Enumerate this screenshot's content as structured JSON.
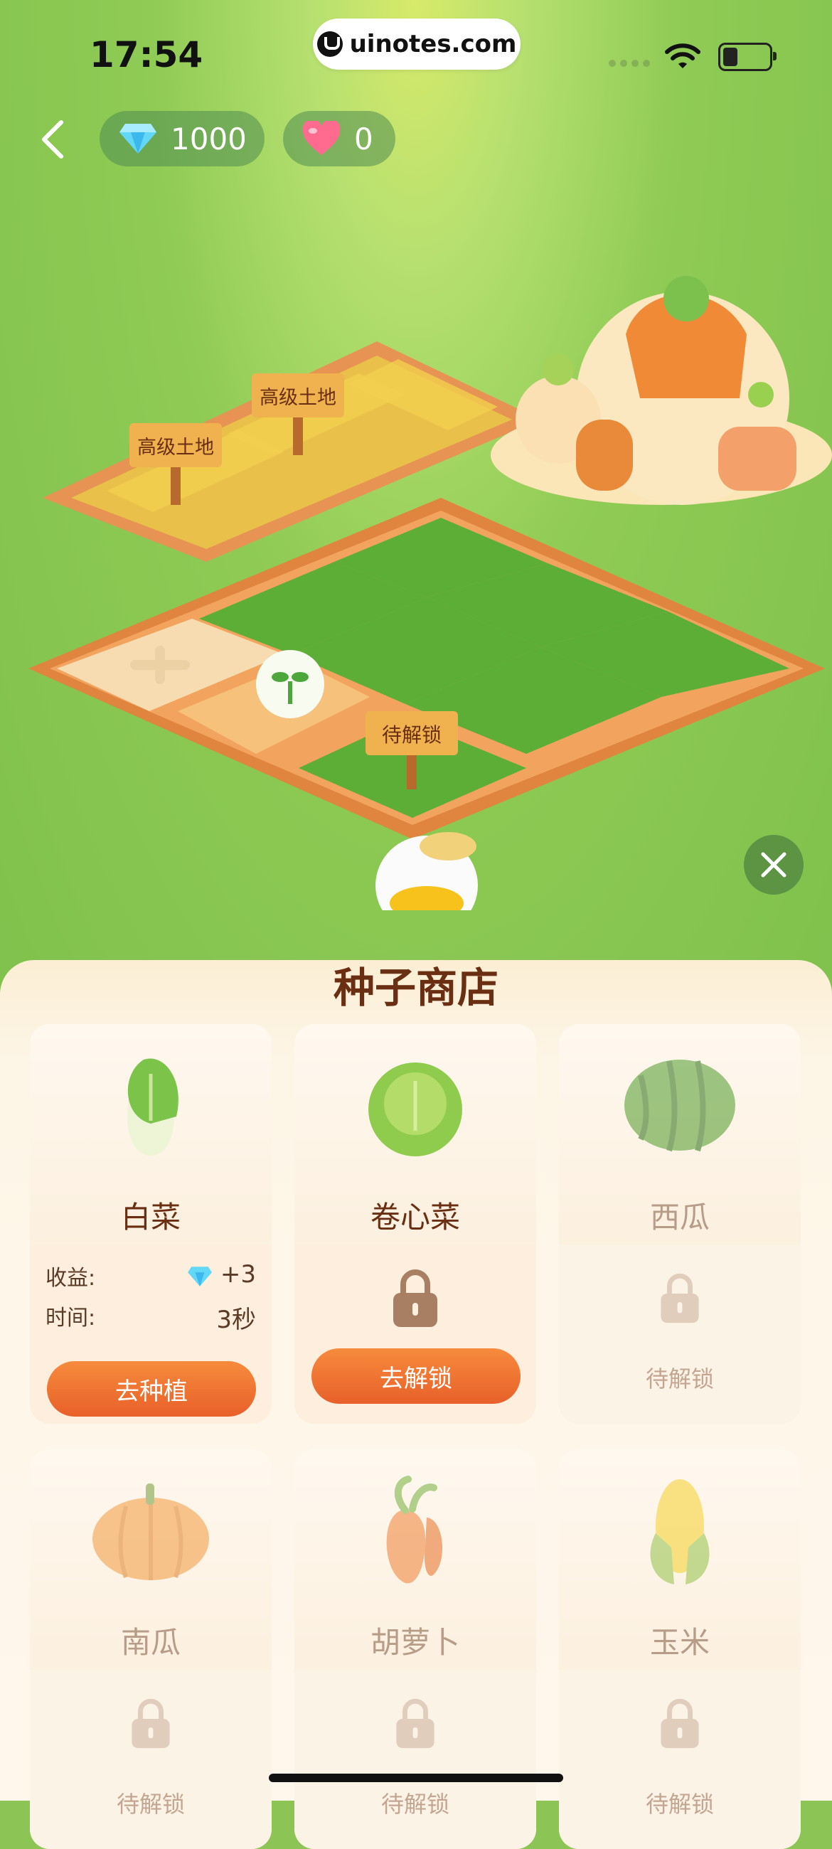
{
  "status_bar": {
    "time": "17:54",
    "url": "uinotes.com"
  },
  "header": {
    "gems": "1000",
    "hearts": "0"
  },
  "farm": {
    "signs": {
      "premium_land": "高级土地",
      "locked": "待解锁"
    }
  },
  "shop": {
    "title": "种子商店",
    "labels": {
      "income": "收益:",
      "time": "时间:"
    },
    "items": [
      {
        "name": "白菜",
        "income": "+3",
        "time": "3秒",
        "action": "去种植"
      },
      {
        "name": "卷心菜",
        "action": "去解锁"
      },
      {
        "name": "西瓜",
        "status": "待解锁"
      },
      {
        "name": "南瓜",
        "status": "待解锁"
      },
      {
        "name": "胡萝卜",
        "status": "待解锁"
      },
      {
        "name": "玉米",
        "status": "待解锁"
      }
    ]
  },
  "icons": {
    "gem": "diamond-icon",
    "heart": "heart-icon",
    "back": "chevron-left-icon",
    "close": "close-icon",
    "lock": "lock-icon"
  }
}
